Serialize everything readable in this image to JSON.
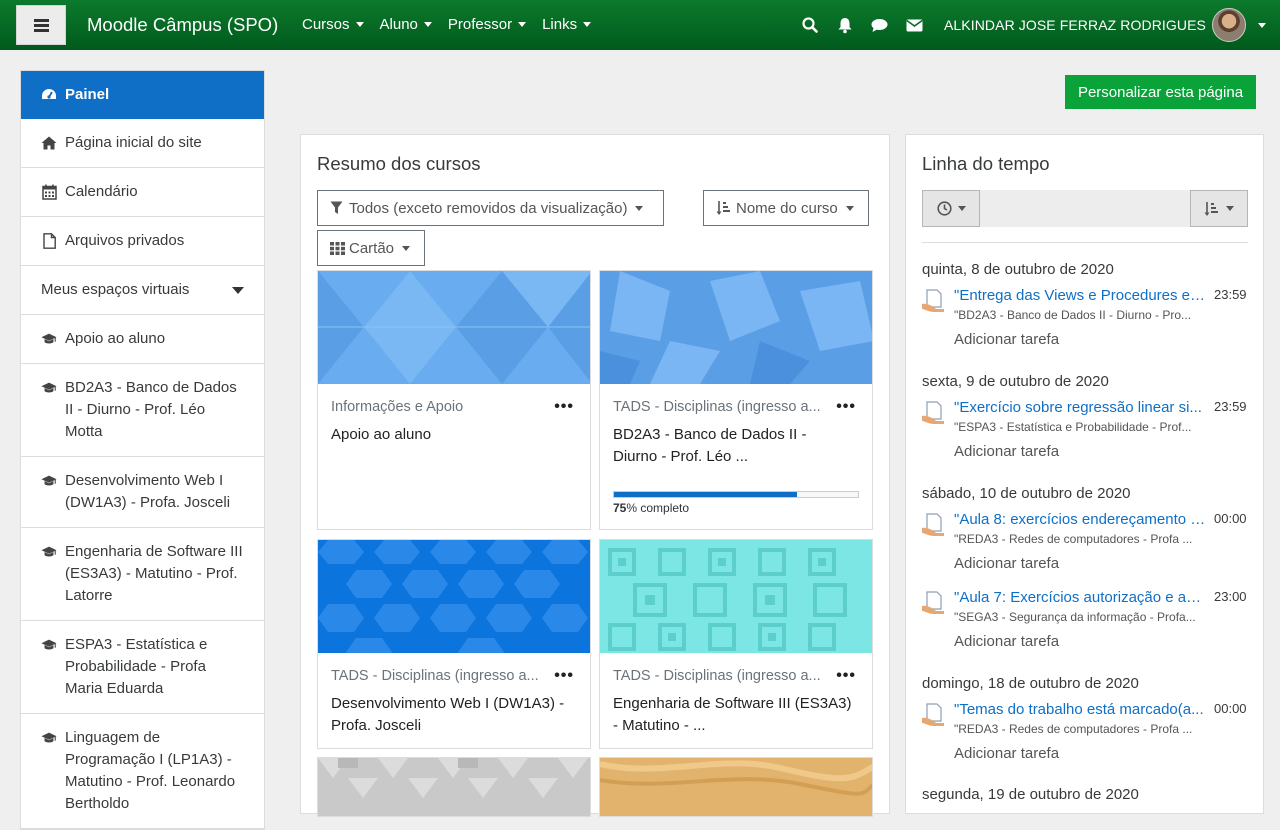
{
  "navbar": {
    "brand": "Moodle Câmpus (SPO)",
    "menu": [
      "Cursos",
      "Aluno",
      "Professor",
      "Links"
    ],
    "user_name": "ALKINDAR JOSE FERRAZ RODRIGUES",
    "colors": {
      "bar": "#0c7a2c",
      "accent": "#0f6fc6",
      "button": "#0aa33a"
    }
  },
  "sidebar": {
    "items": [
      {
        "icon": "dashboard-icon",
        "label": "Painel"
      },
      {
        "icon": "home-icon",
        "label": "Página inicial do site"
      },
      {
        "icon": "calendar-icon",
        "label": "Calendário"
      },
      {
        "icon": "file-icon",
        "label": "Arquivos privados"
      },
      {
        "icon": "chevron-down-icon",
        "label": "Meus espaços virtuais"
      },
      {
        "icon": "graduation-cap-icon",
        "label": "Apoio ao aluno"
      },
      {
        "icon": "graduation-cap-icon",
        "label": "BD2A3 - Banco de Dados II - Diurno - Prof. Léo Motta"
      },
      {
        "icon": "graduation-cap-icon",
        "label": "Desenvolvimento Web I (DW1A3) - Profa. Josceli"
      },
      {
        "icon": "graduation-cap-icon",
        "label": "Engenharia de Software III (ES3A3) - Matutino - Prof. Latorre"
      },
      {
        "icon": "graduation-cap-icon",
        "label": "ESPA3 - Estatística e Probabilidade - Profa Maria Eduarda"
      },
      {
        "icon": "graduation-cap-icon",
        "label": "Linguagem de Programação I (LP1A3) - Matutino - Prof. Leonardo Bertholdo"
      }
    ]
  },
  "personalize_label": "Personalizar esta página",
  "courses": {
    "title": "Resumo dos cursos",
    "filter_label": "Todos (exceto removidos da visualização)",
    "sort_label": "Nome do curso",
    "view_label": "Cartão",
    "cards": [
      {
        "category": "Informações e Apoio",
        "name": "Apoio ao aluno",
        "progress_percent": null,
        "progress_label": ""
      },
      {
        "category": "TADS - Disciplinas (ingresso a...",
        "name": "BD2A3 - Banco de Dados II - Diurno - Prof. Léo ...",
        "progress_percent": 75,
        "progress_label": "completo"
      },
      {
        "category": "TADS - Disciplinas (ingresso a...",
        "name": "Desenvolvimento Web I (DW1A3) - Profa. Josceli",
        "progress_percent": null,
        "progress_label": ""
      },
      {
        "category": "TADS - Disciplinas (ingresso a...",
        "name": "Engenharia de Software III (ES3A3) - Matutino - ...",
        "progress_percent": null,
        "progress_label": ""
      }
    ],
    "dots": "•••"
  },
  "timeline": {
    "title": "Linha do tempo",
    "groups": [
      {
        "date": "quinta, 8 de outubro de 2020",
        "events": [
          {
            "title": "\"Entrega das Views e Procedures es...",
            "time": "23:59",
            "course": "\"BD2A3 - Banco de Dados II - Diurno - Pro...",
            "action": "Adicionar tarefa"
          }
        ]
      },
      {
        "date": "sexta, 9 de outubro de 2020",
        "events": [
          {
            "title": "\"Exercício sobre regressão linear si...",
            "time": "23:59",
            "course": "\"ESPA3 - Estatística e Probabilidade - Prof...",
            "action": "Adicionar tarefa"
          }
        ]
      },
      {
        "date": "sábado, 10 de outubro de 2020",
        "events": [
          {
            "title": "\"Aula 8: exercícios endereçamento I...",
            "time": "00:00",
            "course": "\"REDA3 - Redes de computadores - Profa ...",
            "action": "Adicionar tarefa"
          },
          {
            "title": "\"Aula 7: Exercícios autorização e au...",
            "time": "23:00",
            "course": "\"SEGA3 - Segurança da informação - Profa...",
            "action": "Adicionar tarefa"
          }
        ]
      },
      {
        "date": "domingo, 18 de outubro de 2020",
        "events": [
          {
            "title": "\"Temas do trabalho está marcado(a...",
            "time": "00:00",
            "course": "\"REDA3 - Redes de computadores - Profa ...",
            "action": "Adicionar tarefa"
          }
        ]
      },
      {
        "date": "segunda, 19 de outubro de 2020",
        "events": []
      }
    ]
  }
}
